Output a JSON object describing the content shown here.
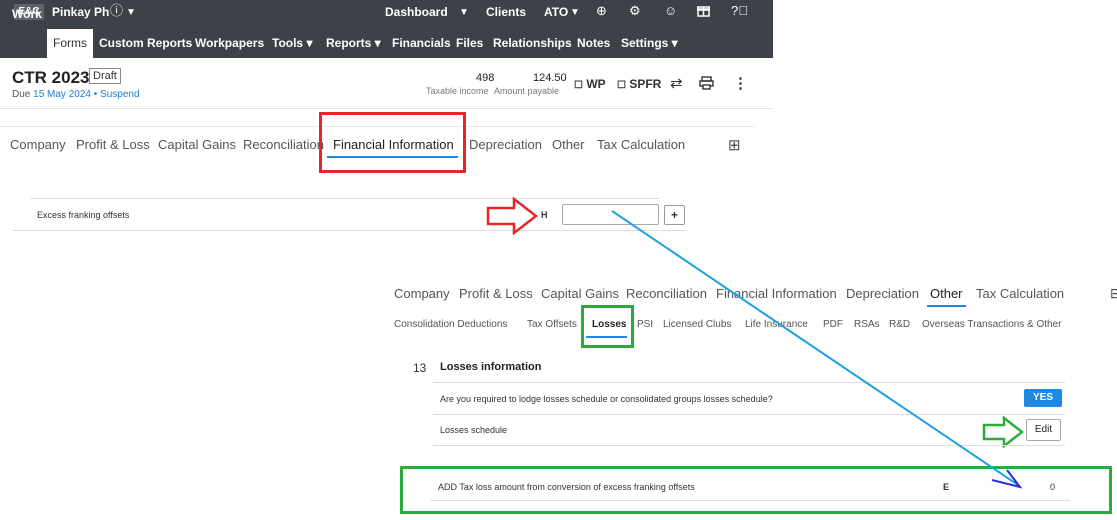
{
  "topbar": {
    "org_badge": "E&C",
    "user": "Pinkay Ph",
    "dashboard": "Dashboard",
    "clients": "Clients",
    "ato": "ATO"
  },
  "nav": {
    "items": [
      "Work",
      "Forms",
      "Custom Reports",
      "Workpapers",
      "Tools ▾",
      "Reports ▾",
      "Financials",
      "Files",
      "Relationships",
      "Notes",
      "Settings ▾"
    ],
    "active": "Forms"
  },
  "header": {
    "title": "CTR 2023",
    "status": "Draft",
    "due_prefix": "Due",
    "due_date": "15 May 2024",
    "due_sep": "•",
    "suspend": "Suspend",
    "taxable_income_value": "498",
    "taxable_income_label": "Taxable income",
    "amount_payable_value": "124.50",
    "amount_payable_label": "Amount payable",
    "wp_label": "WP",
    "spfr_label": "SPFR"
  },
  "tabs1": [
    "Company",
    "Profit & Loss",
    "Capital Gains",
    "Reconciliation",
    "Financial Information",
    "Depreciation",
    "Other",
    "Tax Calculation"
  ],
  "tabs1_active": "Financial Information",
  "excess_row": {
    "label": "Excess franking offsets",
    "code": "H",
    "value": "",
    "plus": "+"
  },
  "tabs2": [
    "Company",
    "Profit & Loss",
    "Capital Gains",
    "Reconciliation",
    "Financial Information",
    "Depreciation",
    "Other",
    "Tax Calculation"
  ],
  "tabs2_active": "Other",
  "subtabs": [
    "Consolidation Deductions",
    "Tax Offsets",
    "Losses",
    "PSI",
    "Licensed Clubs",
    "Life Insurance",
    "PDF",
    "RSAs",
    "R&D",
    "Overseas Transactions & Other"
  ],
  "subtabs_active": "Losses",
  "losses": {
    "number": "13",
    "title": "Losses information",
    "q1": "Are you required to lodge losses schedule or consolidated groups losses schedule?",
    "q1_answer": "YES",
    "schedule_label": "Losses schedule",
    "edit": "Edit"
  },
  "add_row": {
    "label": "ADD Tax loss amount from conversion of excess franking offsets",
    "code": "E",
    "value": "0"
  },
  "colors": {
    "topbar_bg": "#3d4148",
    "accent_blue": "#1e88e5",
    "annot_red": "#e8262a",
    "annot_green": "#2eaa3c",
    "arrow_blue": "#1ea0e0"
  },
  "icons": [
    "info-icon",
    "chevron-down-icon",
    "plus-circle-icon",
    "gear-icon",
    "user-icon",
    "gift-icon",
    "help-icon",
    "swap-icon",
    "print-icon",
    "more-icon",
    "grid-icon"
  ]
}
